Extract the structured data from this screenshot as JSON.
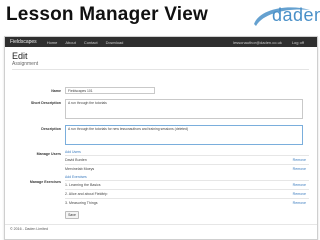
{
  "slide": {
    "title": "Lesson Manager View"
  },
  "logo": {
    "text": "daden",
    "color": "#4a90c8"
  },
  "navbar": {
    "brand": "Fieldscapes",
    "links": [
      "Home",
      "About",
      "Contact",
      "Download"
    ],
    "user_email": "lessonauthor@daden.co.uk",
    "logout": "Log off"
  },
  "page": {
    "heading": "Edit",
    "subheading": "Assignment"
  },
  "form": {
    "name_label": "Name",
    "name_value": "Fieldscapes 101",
    "short_desc_label": "Short Description",
    "short_desc_value": "A run through the tutorials",
    "desc_label": "Description",
    "desc_value": "A run through the tutorials for new lessonauthors and training sessions (deleted)",
    "manage_users_label": "Manage Users",
    "add_users_link": "Add Users",
    "users": [
      {
        "name": "David Burden",
        "action": "Remove"
      },
      {
        "name": "Mervinelab Moeys",
        "action": "Remove"
      }
    ],
    "manage_exercises_label": "Manage Exercises",
    "add_exercise_link": "Add Exercises",
    "exercises": [
      {
        "name": "1. Learning the Basics",
        "action": "Remove"
      },
      {
        "name": "2. Alice and about Fieldtrip",
        "action": "Remove"
      },
      {
        "name": "3. Measuring Things",
        "action": "Remove"
      }
    ],
    "save_label": "Save"
  },
  "footer": {
    "text": "© 2016 - Daden Limited"
  }
}
